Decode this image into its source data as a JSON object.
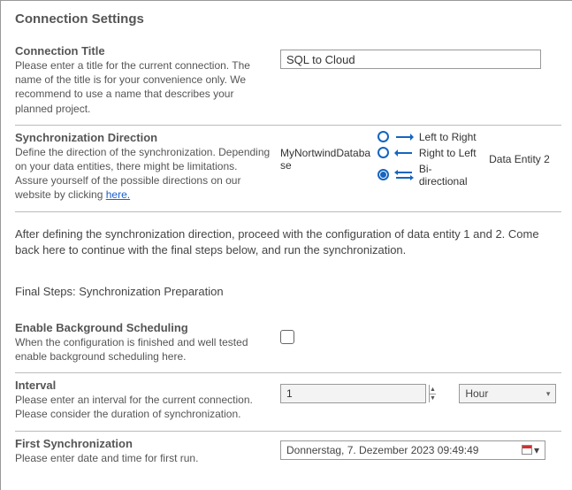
{
  "page_title": "Connection Settings",
  "conn_title": {
    "label": "Connection Title",
    "help": "Please enter a title for the current connection. The name of the title is for your convenience only. We recommend to use a name that describes your planned project.",
    "value": "SQL to Cloud"
  },
  "sync_dir": {
    "label": "Synchronization Direction",
    "help_pre": "Define the direction of the synchronization. Depending on your data entities, there might be limitations. Assure yourself of the possible directions on our website by clicking ",
    "help_link": "here.",
    "entity1": "MyNortwindDatabase",
    "entity2": "Data Entity 2",
    "options": {
      "lr": "Left to Right",
      "rl": "Right to Left",
      "bi": "Bi-directional"
    },
    "selected": "bi"
  },
  "info_text": "After defining the synchronization direction, proceed with the configuration of data entity 1 and 2. Come back here to continue with the final steps below, and run the synchronization.",
  "final_steps_header": "Final Steps: Synchronization Preparation",
  "bg_sched": {
    "label": "Enable Background Scheduling",
    "help": "When the configuration is finished and well tested enable background scheduling here."
  },
  "interval": {
    "label": "Interval",
    "help": "Please enter an interval for the current connection. Please consider the duration of synchronization.",
    "value": "1",
    "unit": "Hour"
  },
  "first_sync": {
    "label": "First Synchronization",
    "help": "Please enter date and time for first run.",
    "value": "Donnerstag,   7. Dezember  2023 09:49:49"
  }
}
